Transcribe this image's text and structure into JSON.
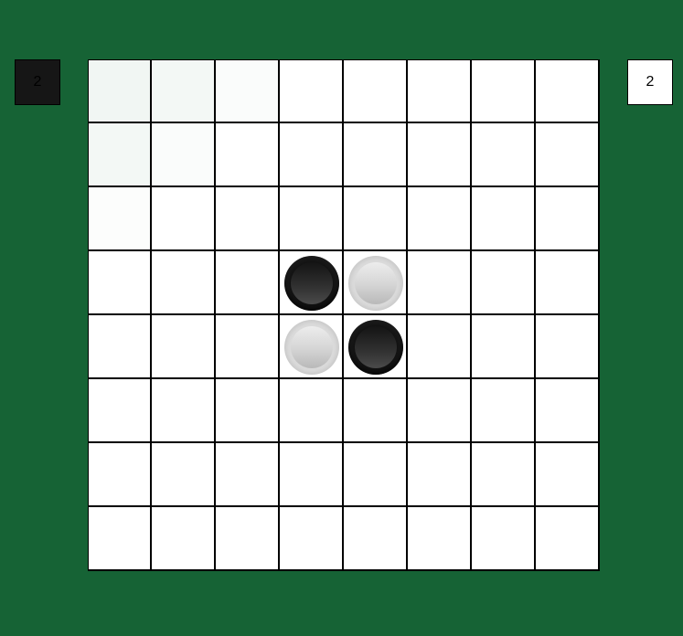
{
  "scores": {
    "black": "2",
    "white": "2"
  },
  "board": {
    "size": 8,
    "pieces": [
      {
        "row": 3,
        "col": 3,
        "color": "black"
      },
      {
        "row": 3,
        "col": 4,
        "color": "white"
      },
      {
        "row": 4,
        "col": 3,
        "color": "white"
      },
      {
        "row": 4,
        "col": 4,
        "color": "black"
      }
    ],
    "tints": [
      {
        "row": 0,
        "col": 0,
        "color": "#f1f6f3"
      },
      {
        "row": 0,
        "col": 1,
        "color": "#f3f8f5"
      },
      {
        "row": 0,
        "col": 2,
        "color": "#fafcfb"
      },
      {
        "row": 1,
        "col": 0,
        "color": "#f3f8f5"
      },
      {
        "row": 1,
        "col": 1,
        "color": "#fafcfb"
      },
      {
        "row": 2,
        "col": 0,
        "color": "#fcfdfc"
      }
    ]
  },
  "colors": {
    "table": "#166335",
    "cell": "#ffffff",
    "grid": "#000000"
  }
}
